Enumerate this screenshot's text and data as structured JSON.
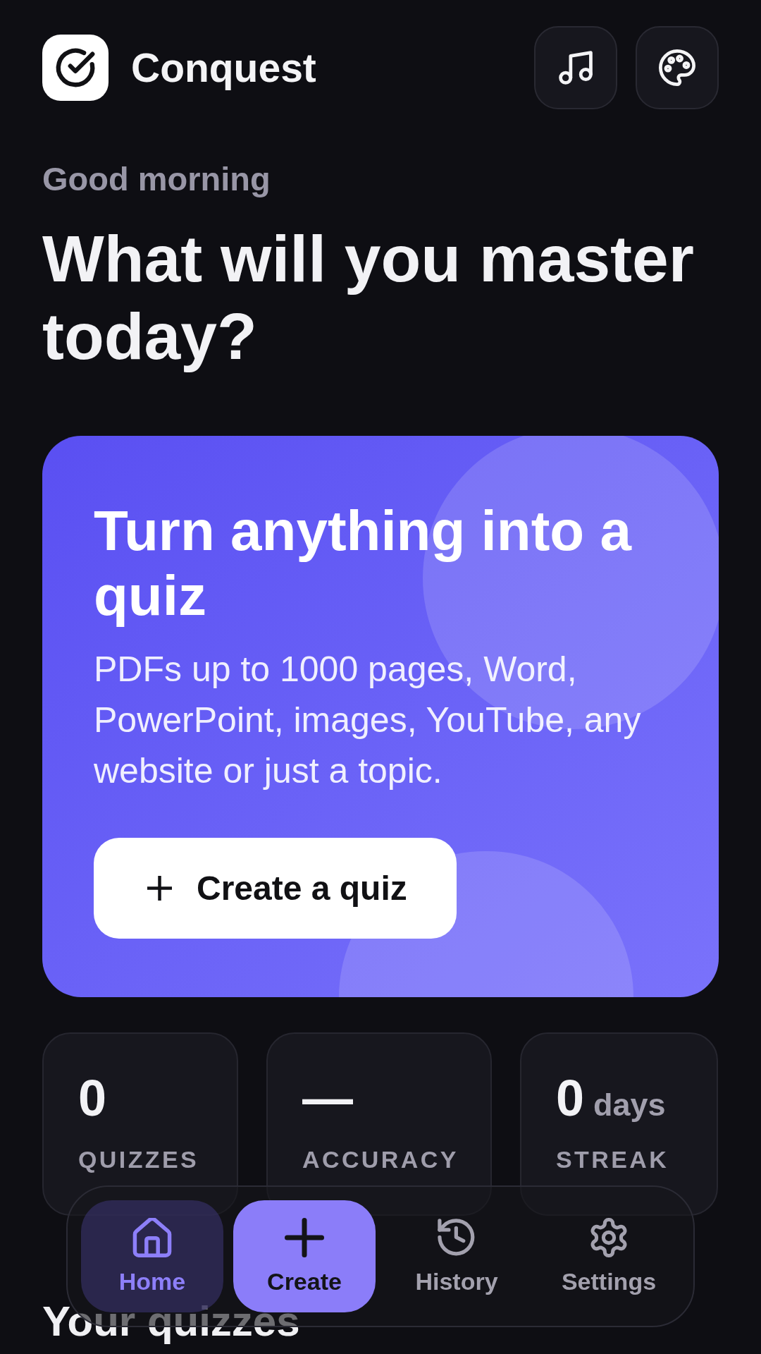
{
  "header": {
    "title": "Conquest"
  },
  "greeting": "Good morning",
  "headline": "What will you master today?",
  "hero_card": {
    "title": "Turn anything into a quiz",
    "description": "PDFs up to 1000 pages, Word, PowerPoint, images, YouTube, any website or just a topic.",
    "button": "Create a quiz"
  },
  "stats": [
    {
      "value": "0",
      "label": "QUIZZES"
    },
    {
      "value": "—",
      "label": "ACCURACY"
    },
    {
      "value": "0",
      "unit": "days",
      "label": "STREAK"
    }
  ],
  "section_title": "Your quizzes",
  "bottom_nav": [
    {
      "label": "Home",
      "kind": "tab",
      "selected": true
    },
    {
      "label": "Create",
      "kind": "primary",
      "selected": false
    },
    {
      "label": "History",
      "kind": "tab",
      "selected": false
    },
    {
      "label": "Settings",
      "kind": "tab",
      "selected": false
    }
  ]
}
